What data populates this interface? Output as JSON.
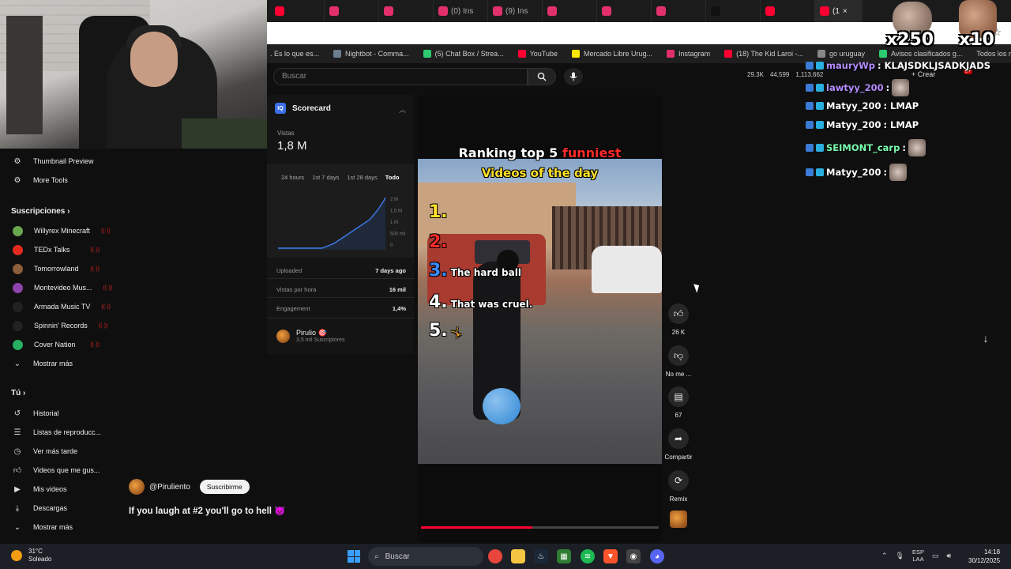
{
  "browser": {
    "active_tab_label": "(1",
    "tabs": [
      {
        "color": "#ff0033",
        "label": ""
      },
      {
        "color": "#e1306c",
        "label": ""
      },
      {
        "color": "#e1306c",
        "label": ""
      },
      {
        "color": "#e1306c",
        "label": "(0) Ins"
      },
      {
        "color": "#e1306c",
        "label": "(9) Ins"
      },
      {
        "color": "#e1306c",
        "label": ""
      },
      {
        "color": "#e1306c",
        "label": ""
      },
      {
        "color": "#e1306c",
        "label": ""
      },
      {
        "color": "#111111",
        "label": ""
      },
      {
        "color": "#ff0033",
        "label": ""
      }
    ],
    "bookmarks": [
      {
        "label": ". Es lo que es...",
        "color": ""
      },
      {
        "label": "Nightbot - Comma...",
        "color": "#6b7d8f"
      },
      {
        "label": "(5) Chat Box / Strea...",
        "color": "#2ecc71"
      },
      {
        "label": "YouTube",
        "color": "#ff0033"
      },
      {
        "label": "Mercado Libre Urug...",
        "color": "#ffe600"
      },
      {
        "label": "Instagram",
        "color": "#e1306c"
      },
      {
        "label": "(18) The Kid Laroi -...",
        "color": "#ff0033"
      },
      {
        "label": "go uruguay",
        "color": "#888888"
      },
      {
        "label": "Avisos clasificados g...",
        "color": "#2ecc71"
      }
    ],
    "bookmarks_right": "Todos los marcadores"
  },
  "search": {
    "placeholder": "Buscar"
  },
  "header_stats": {
    "stat1": "29.3K",
    "stat2": "44,599",
    "stat3": "1,113,662",
    "create_label": "+ Crear",
    "notif_badge": "9+"
  },
  "sidebar": {
    "top_items": [
      {
        "label": "Thumbnail Preview",
        "icon": "gear-icon"
      },
      {
        "label": "More Tools",
        "icon": "gear-icon"
      }
    ],
    "subs_heading": "Suscripciones",
    "subscriptions": [
      {
        "label": "Willyrex Minecraft",
        "color": "#6aa84f"
      },
      {
        "label": "TEDx Talks",
        "color": "#e62b1e"
      },
      {
        "label": "Tomorrowland",
        "color": "#8b5e3c"
      },
      {
        "label": "Montevideo Mus...",
        "color": "#8e44ad"
      },
      {
        "label": "Armada Music TV",
        "color": "#222222"
      },
      {
        "label": "Spinnin' Records",
        "color": "#222222"
      },
      {
        "label": "Cover Nation",
        "color": "#27ae60"
      }
    ],
    "live_indicator": "((·))",
    "show_more": "Mostrar más",
    "you_heading": "Tú",
    "you_items": [
      {
        "label": "Historial",
        "icon": "history-icon"
      },
      {
        "label": "Listas de reproducc...",
        "icon": "playlist-icon"
      },
      {
        "label": "Ver más tarde",
        "icon": "clock-icon"
      },
      {
        "label": "Videos que me gus...",
        "icon": "thumbs-up-icon"
      },
      {
        "label": "Mis videos",
        "icon": "video-icon"
      },
      {
        "label": "Descargas",
        "icon": "download-icon"
      }
    ],
    "show_more_2": "Mostrar más"
  },
  "scorecard": {
    "title": "Scorecard",
    "views_label": "Vistas",
    "views_value": "1,8 M",
    "ranges": [
      "24 hours",
      "1st 7 days",
      "1st 28 days",
      "Todo"
    ],
    "active_range": "Todo",
    "chart_ticks": [
      "2 M",
      "1,5 M",
      "1 M",
      "500 mil",
      "0"
    ],
    "uploaded_label": "Uploaded",
    "uploaded_value": "7 days ago",
    "vph_label": "Vistas por hora",
    "vph_value": "16 mil",
    "engagement_label": "Engagement",
    "engagement_value": "1,4%",
    "channel_name": "Pirulio 🎯",
    "channel_subs": "3,5 mil Suscriptores"
  },
  "video": {
    "title_line_white": "Ranking top 5 ",
    "title_line_red": "funniest",
    "subtitle": "Videos of the day",
    "ranks": [
      {
        "num": "1.",
        "text": "",
        "color": "#ffe22a"
      },
      {
        "num": "2.",
        "text": "",
        "color": "#ff2a2a"
      },
      {
        "num": "3.",
        "text": "The hard ball",
        "color": "#3b8dff"
      },
      {
        "num": "4.",
        "text": "That was cruel.",
        "color": "#ffffff"
      },
      {
        "num": "5.",
        "text": "🤸",
        "color": "#ffffff"
      }
    ],
    "progress": 0.47
  },
  "actions": {
    "like_count": "26 K",
    "dislike_label": "No me ...",
    "comments_count": "67",
    "share_label": "Compartir",
    "remix_label": "Remix"
  },
  "channel": {
    "handle": "@Piruliento",
    "subscribe_label": "Suscribirme",
    "video_title": "If you laugh at #2 you'll go to hell 😈"
  },
  "chat": {
    "lines": [
      {
        "user": "mauryWp",
        "message": ": KLAJSDKLJSADKJADS",
        "color": "#b48cff"
      },
      {
        "user": "lawtyy_200",
        "message": ":",
        "color": "#b48cff",
        "emote": true
      },
      {
        "user": "Matyy_200",
        "message": ": LMAP",
        "color": "#ffffff"
      },
      {
        "user": "Matyy_200",
        "message": ": LMAP",
        "color": "#ffffff"
      },
      {
        "user": "SEIMONT_carp",
        "message": ":",
        "color": "#7cffb0",
        "emote": true
      },
      {
        "user": "Matyy_200",
        "message": ":",
        "color": "#ffffff",
        "emote": true
      }
    ]
  },
  "emote_overlay": {
    "count_a": "x250",
    "count_b": "x10"
  },
  "taskbar": {
    "temperature": "31°C",
    "weather": "Soleado",
    "search_placeholder": "Buscar",
    "lang_top": "ESP",
    "lang_bottom": "LAA",
    "time": "14:18",
    "date": "30/12/2025"
  }
}
